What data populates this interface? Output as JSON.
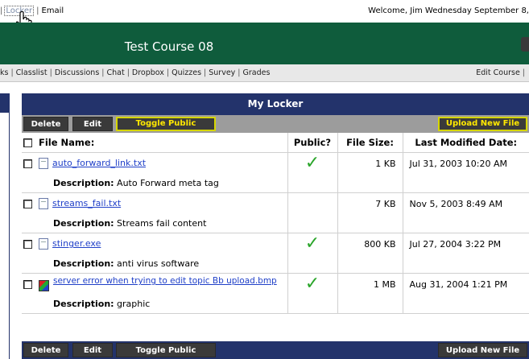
{
  "topbar": {
    "locker_link": "Locker",
    "separator": "|",
    "email_link": "Email",
    "welcome": "Welcome, Jim  Wednesday September 8,"
  },
  "banner": {
    "course_title": "Test Course 08"
  },
  "navbar": {
    "items": [
      "ks",
      "Classlist",
      "Discussions",
      "Chat",
      "Dropbox",
      "Quizzes",
      "Survey",
      "Grades"
    ],
    "edit_course": "Edit Course"
  },
  "panel": {
    "title": "My Locker",
    "buttons": {
      "delete": "Delete",
      "edit": "Edit",
      "toggle_public": "Toggle Public",
      "upload": "Upload New File"
    },
    "columns": {
      "file_name": "File Name:",
      "public": "Public?",
      "file_size": "File Size:",
      "modified": "Last Modified Date:"
    },
    "description_label": "Description:",
    "files": [
      {
        "name": "auto_forward_link.txt",
        "public": true,
        "size": "1 KB",
        "modified": "Jul 31, 2003 10:20 AM",
        "description": "Auto Forward meta tag",
        "icon": "text-file-icon"
      },
      {
        "name": "streams_fail.txt",
        "public": false,
        "size": "7 KB",
        "modified": "Nov 5, 2003 8:49 AM",
        "description": "Streams fail content",
        "icon": "text-file-icon"
      },
      {
        "name": "stinger.exe",
        "public": true,
        "size": "800 KB",
        "modified": "Jul 27, 2004 3:22 PM",
        "description": "anti virus software",
        "icon": "text-file-icon"
      },
      {
        "name": "server error when trying to edit topic Bb upload.bmp",
        "public": true,
        "size": "1 MB",
        "modified": "Aug 31, 2004 1:21 PM",
        "description": "graphic",
        "icon": "bitmap-file-icon"
      }
    ],
    "checkmark": "✓"
  },
  "colors": {
    "banner": "#0f5c3c",
    "panel_header": "#23336b",
    "highlight": "#d6d600",
    "check": "#2aa52a",
    "link": "#2040c8"
  }
}
